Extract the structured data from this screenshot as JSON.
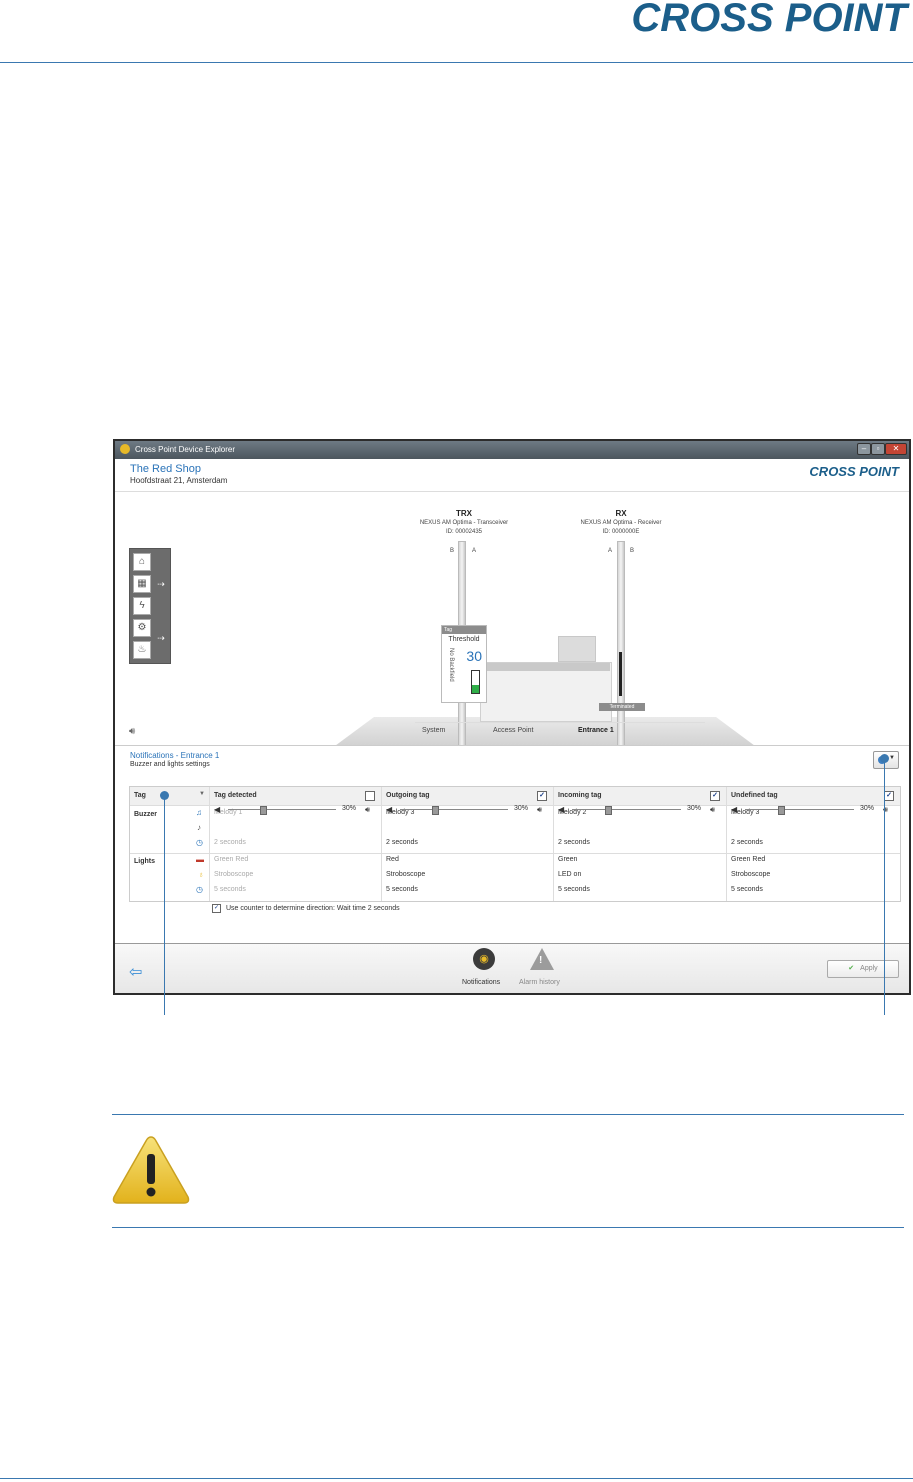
{
  "doc": {
    "logo": "CROSS POINT"
  },
  "window": {
    "title": "Cross Point Device Explorer",
    "controls": {
      "minimize": "–",
      "maximize": "▫",
      "close": "✕"
    }
  },
  "shop": {
    "name": "The Red Shop",
    "address": "Hoofdstraat 21, Amsterdam",
    "logo": "CROSS POINT"
  },
  "scene": {
    "trx": {
      "name": "TRX",
      "model": "NEXUS AM Optima - Transceiver",
      "id": "ID: 00002435",
      "a": "A",
      "b": "B"
    },
    "rx": {
      "name": "RX",
      "model": "NEXUS AM Optima - Receiver",
      "id": "ID: 0000000E",
      "a": "A",
      "b": "B"
    },
    "threshold": {
      "tag": "Tag",
      "title": "Threshold",
      "value": "30",
      "backfield": "No Backfield",
      "level": 0.35
    },
    "terminated": "Terminated"
  },
  "breadcrumb": {
    "system": "System",
    "access_point": "Access Point",
    "entrance": "Entrance 1"
  },
  "notifications": {
    "title": "Notifications - Entrance 1",
    "subtitle": "Buzzer and lights settings",
    "first_column": "Tag",
    "row_buzzer": "Buzzer",
    "row_lights": "Lights",
    "columns": [
      {
        "header": "Tag detected",
        "checked": false,
        "melody": "Melody 1",
        "volume": "30%",
        "volume_level": 0.3,
        "buzz_time": "2 seconds",
        "light_color": "Green Red",
        "light_mode": "Stroboscope",
        "light_time": "5 seconds",
        "enabled": false
      },
      {
        "header": "Outgoing tag",
        "checked": true,
        "melody": "Melody 3",
        "volume": "30%",
        "volume_level": 0.3,
        "buzz_time": "2 seconds",
        "light_color": "Red",
        "light_mode": "Stroboscope",
        "light_time": "5 seconds",
        "enabled": true
      },
      {
        "header": "Incoming tag",
        "checked": true,
        "melody": "Melody 2",
        "volume": "30%",
        "volume_level": 0.3,
        "buzz_time": "2 seconds",
        "light_color": "Green",
        "light_mode": "LED on",
        "light_time": "5 seconds",
        "enabled": true
      },
      {
        "header": "Undefined tag",
        "checked": true,
        "melody": "Melody 3",
        "volume": "30%",
        "volume_level": 0.3,
        "buzz_time": "2 seconds",
        "light_color": "Green Red",
        "light_mode": "Stroboscope",
        "light_time": "5 seconds",
        "enabled": true
      }
    ],
    "counter_option": "Use counter to determine direction: Wait time",
    "counter_wait": "2 seconds"
  },
  "bottom": {
    "notifications_tab": "Notifications",
    "alarm_tab": "Alarm history",
    "apply": "Apply"
  },
  "colors": {
    "accent": "#2a73b8",
    "brand": "#1b5e8a",
    "rule": "#3a78b0"
  }
}
